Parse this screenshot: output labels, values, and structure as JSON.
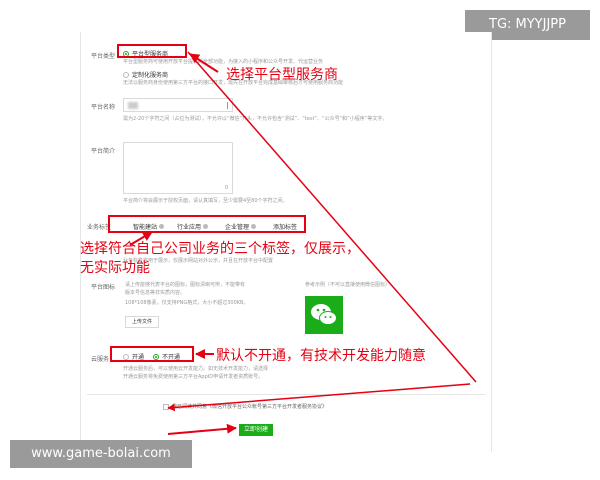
{
  "watermarks": {
    "top": "TG: MYYJJPP",
    "bottom": "www.game-bolai.com"
  },
  "form": {
    "platform_type": {
      "label": "平台类型",
      "opt1": "平台型服务商",
      "opt1_desc": "平台型服务商可使用开放平台提供的全部功能，为接入的小程序和公众号开发、代运营业务",
      "opt2": "定制化服务商",
      "opt2_desc": "无法以服务商身份使用第三方平台的接口开发，需先在开放平台完成基础审核后才可使用服务商功能"
    },
    "platform_name": {
      "label": "平台名称",
      "hint": "需为2-20个字符之间（占位为测试），不允许以“微信”开头，不允许包含“测试”、“test”、“公众号”和“小程序”等文字。"
    },
    "platform_intro": {
      "label": "平台简介",
      "counter": "0",
      "hint": "平台简介将会展示于授权页面，请认真填写，至少需要4至80个字符之间。"
    },
    "business_tags": {
      "label": "业务标签",
      "tags": [
        "智能建站",
        "行业应用",
        "企业管理",
        "添加标签"
      ],
      "hint": "业务标签将用于展示，仅展示网站对外公示，并且在开放平台中配置"
    },
    "platform_icon": {
      "label": "平台图标",
      "hint1": "请上传能够代表平台的图标，图标清晰可辨，不能带有",
      "hint2": "版本号信息等非实质内容。",
      "hint3": "108*108像素，仅支持PNG格式，大小不超过300KB。",
      "upload": "上传文件",
      "example_label": "参考示例（不可以直接使用微信图标）"
    },
    "cloud_service": {
      "label": "云服务",
      "opt_on": "开通",
      "opt_off": "不开通",
      "hint1": "开通云服务后，可以使用云开发能力。如无技术开发能力，请选择",
      "hint2": "开通云服务将免费使用第三方平台AppID申请开发者资质账号。"
    },
    "agree": "我已阅读并同意《微信开放平台公众帐号第三方平台开发者服务协议》",
    "submit": "立即创建"
  },
  "annotations": {
    "a1": "选择平台型服务商",
    "a2_line1": "选择符合自己公司业务的三个标签，仅展示，",
    "a2_line2": "无实际功能",
    "a3": "默认不开通，有技术开发能力随意"
  },
  "colors": {
    "annotation": "#e60012",
    "brand_green": "#1aad19",
    "watermark_bg": "#9a9a9a"
  },
  "icons": [
    "wechat-logo-icon"
  ]
}
